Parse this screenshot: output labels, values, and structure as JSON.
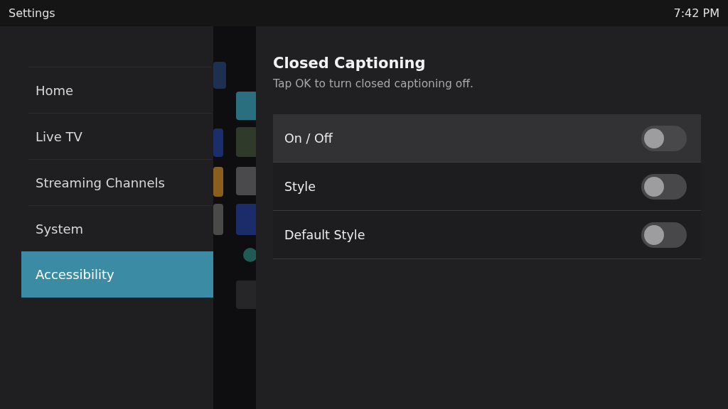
{
  "top_bar": {
    "title": "Settings",
    "time": "7:42 PM"
  },
  "sidebar": {
    "items": [
      {
        "label": "Home",
        "selected": false
      },
      {
        "label": "Live TV",
        "selected": false
      },
      {
        "label": "Streaming Channels",
        "selected": false
      },
      {
        "label": "System",
        "selected": false
      },
      {
        "label": "Accessibility",
        "selected": true
      }
    ]
  },
  "panel": {
    "title": "Closed Captioning",
    "subtitle": "Tap OK to turn closed captioning off.",
    "rows": [
      {
        "label": "On / Off",
        "on": false,
        "selected": true
      },
      {
        "label": "Style",
        "on": false,
        "selected": false
      },
      {
        "label": "Default Style",
        "on": false,
        "selected": false
      }
    ]
  }
}
